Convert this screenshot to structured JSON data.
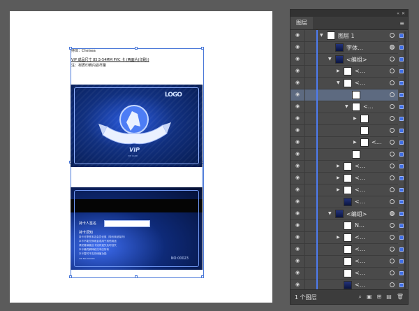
{
  "artboard": {
    "spec_lines": [
      "持体：Chelsea",
      "VIP 成品尺寸 85.5-54MM PVC 卡 (两面片(印刷))",
      "注：材质印刷内容尽量"
    ]
  },
  "card_front": {
    "logo_text": "LOGO",
    "vip_text": "VIP",
    "vip_sub": "VIP CARD"
  },
  "card_back": {
    "signature_label": "持卡人签名",
    "notice_title": "持卡须知",
    "notices": [
      "持卡可享受本店会员优惠（特价商品除外）",
      "本卡不能兑换现金或用于其他用途",
      "请妥善保管此卡如有遗失及时挂失",
      "本卡最终解释权归本店所有",
      "本卡暂时不支持储值功能"
    ],
    "small_text": "VIP NO.000000",
    "number": "NO:00023"
  },
  "layers_panel": {
    "title": "图层",
    "footer_label": "1 个图层",
    "rows": [
      {
        "label": "图层 1",
        "indent": 0,
        "expanded": true,
        "thumb": "white",
        "selected": false,
        "target_filled": false
      },
      {
        "label": "字体…",
        "indent": 1,
        "expanded": null,
        "thumb": "dark",
        "selected": false,
        "target_filled": true
      },
      {
        "label": "<编组>",
        "indent": 1,
        "expanded": true,
        "thumb": "dark",
        "selected": false,
        "target_filled": false
      },
      {
        "label": "<…",
        "indent": 2,
        "expanded": false,
        "thumb": "white",
        "selected": false,
        "target_filled": false
      },
      {
        "label": "<…",
        "indent": 2,
        "expanded": true,
        "thumb": "white",
        "selected": false,
        "target_filled": false
      },
      {
        "label": "",
        "indent": 3,
        "expanded": null,
        "thumb": "white",
        "selected": true,
        "target_filled": false
      },
      {
        "label": "<…",
        "indent": 3,
        "expanded": true,
        "thumb": "white",
        "selected": false,
        "target_filled": false
      },
      {
        "label": "",
        "indent": 4,
        "expanded": false,
        "thumb": "white",
        "selected": false,
        "target_filled": false
      },
      {
        "label": "",
        "indent": 4,
        "expanded": null,
        "thumb": "white",
        "selected": false,
        "target_filled": false
      },
      {
        "label": "<…",
        "indent": 4,
        "expanded": false,
        "thumb": "white",
        "selected": false,
        "target_filled": false
      },
      {
        "label": "",
        "indent": 3,
        "expanded": null,
        "thumb": "white",
        "selected": false,
        "target_filled": false
      },
      {
        "label": "<…",
        "indent": 2,
        "expanded": false,
        "thumb": "white",
        "selected": false,
        "target_filled": false
      },
      {
        "label": "<…",
        "indent": 2,
        "expanded": false,
        "thumb": "white",
        "selected": false,
        "target_filled": false
      },
      {
        "label": "<…",
        "indent": 2,
        "expanded": false,
        "thumb": "white",
        "selected": false,
        "target_filled": false
      },
      {
        "label": "<…",
        "indent": 2,
        "expanded": null,
        "thumb": "dark",
        "selected": false,
        "target_filled": false
      },
      {
        "label": "<编组>",
        "indent": 1,
        "expanded": true,
        "thumb": "dark",
        "selected": false,
        "target_filled": true
      },
      {
        "label": "N…",
        "indent": 2,
        "expanded": null,
        "thumb": "white",
        "selected": false,
        "target_filled": false
      },
      {
        "label": "<…",
        "indent": 2,
        "expanded": false,
        "thumb": "white",
        "selected": false,
        "target_filled": false
      },
      {
        "label": "<…",
        "indent": 2,
        "expanded": null,
        "thumb": "white",
        "selected": false,
        "target_filled": false
      },
      {
        "label": "<…",
        "indent": 2,
        "expanded": null,
        "thumb": "white",
        "selected": false,
        "target_filled": false
      },
      {
        "label": "<…",
        "indent": 2,
        "expanded": null,
        "thumb": "white",
        "selected": false,
        "target_filled": false
      },
      {
        "label": "<…",
        "indent": 2,
        "expanded": null,
        "thumb": "dark",
        "selected": false,
        "target_filled": false
      }
    ]
  },
  "colors": {
    "panel_bg": "#4a4a4a",
    "layer_blue": "#4e7cf0",
    "card_blue": "#11307f",
    "canvas_bg": "#5b5b5b"
  }
}
